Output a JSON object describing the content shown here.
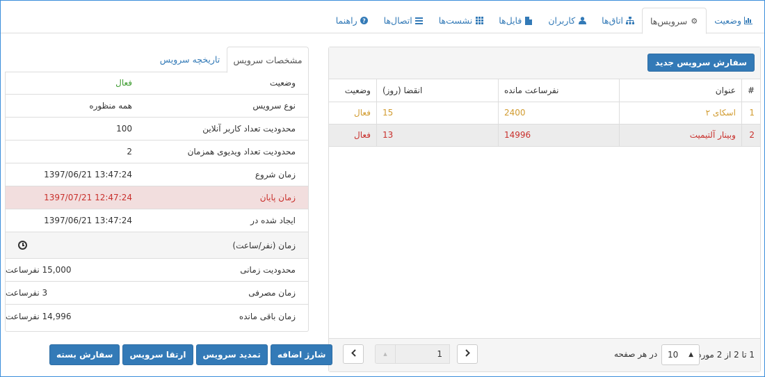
{
  "nav": {
    "tabs": [
      {
        "label": "وضعیت",
        "icon": "bar-chart-icon",
        "active": false
      },
      {
        "label": "سرویس‌ها",
        "icon": "gear-icon",
        "active": true
      },
      {
        "label": "اتاق‌ها",
        "icon": "sitemap-icon",
        "active": false
      },
      {
        "label": "کاربران",
        "icon": "user-icon",
        "active": false
      },
      {
        "label": "فایل‌ها",
        "icon": "file-icon",
        "active": false
      },
      {
        "label": "نشست‌ها",
        "icon": "grid-icon",
        "active": false
      },
      {
        "label": "اتصال‌ها",
        "icon": "list-icon",
        "active": false
      },
      {
        "label": "راهنما",
        "icon": "question-circle-icon",
        "active": false
      }
    ]
  },
  "services": {
    "new_order_label": "سفارش سرویس جدید",
    "columns": {
      "hash": "#",
      "title": "عنوان",
      "remaining": "نفرساعت مانده",
      "expire": "انقضا (روز)",
      "status": "وضعیت"
    },
    "rows": [
      {
        "num": "1",
        "title": "اسکای ۲",
        "remaining": "2400",
        "expire": "15",
        "status": "فعال"
      },
      {
        "num": "2",
        "title": "وبینار آلتیمیت",
        "remaining": "14996",
        "expire": "13",
        "status": "فعال"
      }
    ],
    "footer": {
      "info": "1 تا 2 از 2 مورد",
      "page_size": "10",
      "per_page_label": "در هر صفحه",
      "page": "1"
    }
  },
  "details": {
    "tabs": {
      "specs": "مشخصات سرویس",
      "history": "تاریخچه سرویس"
    },
    "rows": [
      {
        "key": "وضعیت",
        "value": "فعال"
      },
      {
        "key": "نوع سرویس",
        "value": "همه منظوره"
      },
      {
        "key": "محدودیت تعداد کاربر آنلاین",
        "value": "100"
      },
      {
        "key": "محدودیت تعداد ویدیوی همزمان",
        "value": "2"
      },
      {
        "key": "زمان شروع",
        "value": "1397/06/21 13:47:24"
      },
      {
        "key": "زمان پایان",
        "value": "1397/07/21 12:47:24"
      },
      {
        "key": "ایجاد شده در",
        "value": "1397/06/21 13:47:24"
      }
    ],
    "time_section": {
      "title": "زمان (نفر/ساعت)"
    },
    "time_rows": [
      {
        "key": "محدودیت زمانی",
        "value": "15,000 نفرساعت"
      },
      {
        "key": "زمان مصرفی",
        "value": "3 نفرساعت"
      },
      {
        "key": "زمان باقی مانده",
        "value": "14,996 نفرساعت"
      }
    ]
  },
  "actions": {
    "charge": "شارژ اضافه",
    "extend": "تمدید سرویس",
    "upgrade": "ارتقا سرویس",
    "package": "سفارش بسته"
  }
}
